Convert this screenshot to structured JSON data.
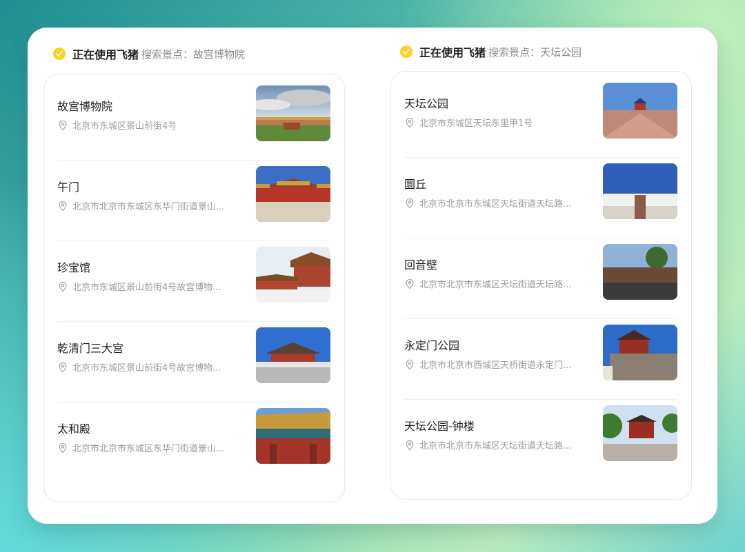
{
  "left": {
    "using_text": "正在使用飞猪",
    "query_label": "搜索景点：",
    "query": "故宫博物院",
    "items": [
      {
        "name": "故宫博物院",
        "address": "北京市东城区景山前街4号",
        "image": "palace-panorama-photo"
      },
      {
        "name": "午门",
        "address": "北京市北京市东城区东华门街道景山...",
        "image": "meridian-gate-photo"
      },
      {
        "name": "珍宝馆",
        "address": "北京市东城区景山前街4号故宫博物...",
        "image": "treasure-hall-photo"
      },
      {
        "name": "乾清门三大宫",
        "address": "北京市东城区景山前街4号故宫博物...",
        "image": "qianqing-gate-photo"
      },
      {
        "name": "太和殿",
        "address": "北京市北京市东城区东华门街道景山...",
        "image": "taihe-hall-photo"
      }
    ]
  },
  "right": {
    "using_text": "正在使用飞猪",
    "query_label": "搜索景点：",
    "query": "天坛公园",
    "items": [
      {
        "name": "天坛公园",
        "address": "北京市东城区天坛东里甲1号",
        "image": "temple-of-heaven-photo"
      },
      {
        "name": "圜丘",
        "address": "北京市北京市东城区天坛街道天坛路...",
        "image": "circular-mound-photo"
      },
      {
        "name": "回音壁",
        "address": "北京市北京市东城区天坛街道天坛路...",
        "image": "echo-wall-photo"
      },
      {
        "name": "永定门公园",
        "address": "北京市北京市西城区天桥街道永定门...",
        "image": "yongding-gate-photo"
      },
      {
        "name": "天坛公园-钟楼",
        "address": "北京市北京市东城区天坛街道天坛路...",
        "image": "bell-tower-photo"
      }
    ]
  },
  "colors": {
    "logo": "#ffd21f",
    "text": "#222222",
    "muted": "#9b9b9b"
  },
  "icons": {
    "logo": "fliggy-logo-icon",
    "pin": "location-pin-icon"
  }
}
